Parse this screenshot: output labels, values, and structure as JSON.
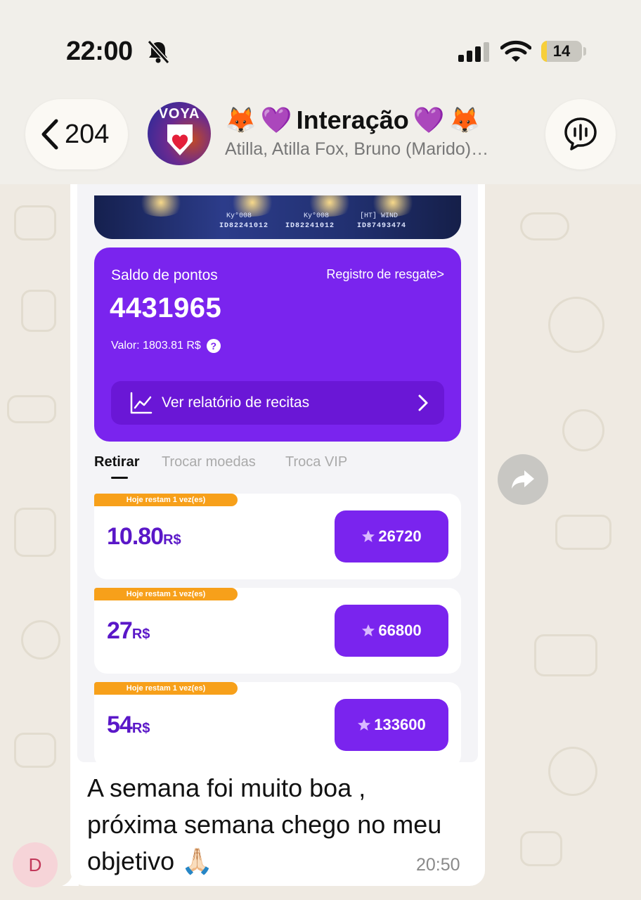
{
  "status_bar": {
    "time": "22:00",
    "battery": "14",
    "battery_level": 0.14
  },
  "header": {
    "back_count": "204",
    "avatar_text": "VOYA",
    "title": "Interação",
    "title_emoji_left": [
      "🦊",
      "💜"
    ],
    "title_emoji_right": [
      "💜",
      "🦊"
    ],
    "members": "Atilla, Atilla Fox, Bruno (Marido)…"
  },
  "screenshot": {
    "banner": {
      "names": [
        "Ky°008",
        "Ky°008",
        "[HT] WIND"
      ],
      "ids": [
        "ID82241012",
        "ID82241012",
        "ID87493474"
      ]
    },
    "points_card": {
      "label": "Saldo de pontos",
      "history_link": "Registro de resgate>",
      "value": "4431965",
      "worth": "Valor: 1803.81 R$",
      "help": "?",
      "report_label": "Ver relatório de recitas"
    },
    "tabs": [
      {
        "label": "Retirar",
        "active": true
      },
      {
        "label": "Trocar moedas",
        "active": false
      },
      {
        "label": "Troca VIP",
        "active": false
      }
    ],
    "offers": [
      {
        "badge": "Hoje restam 1 vez(es)",
        "amount": "10.80",
        "currency": "R$",
        "cost": "26720"
      },
      {
        "badge": "Hoje restam 1 vez(es)",
        "amount": "27",
        "currency": "R$",
        "cost": "66800"
      },
      {
        "badge": "Hoje restam 1 vez(es)",
        "amount": "54",
        "currency": "R$",
        "cost": "133600"
      }
    ]
  },
  "message": {
    "text_line1": "A semana foi muito boa ,",
    "text_line2": "próxima semana chego no meu",
    "text_line3": "objetivo",
    "emoji": "🙏🏻",
    "time": "20:50"
  },
  "sender": {
    "initial": "D"
  },
  "colors": {
    "accent_purple": "#7a24ee",
    "badge_orange": "#f7a01a",
    "chat_background": "#efeae2"
  }
}
